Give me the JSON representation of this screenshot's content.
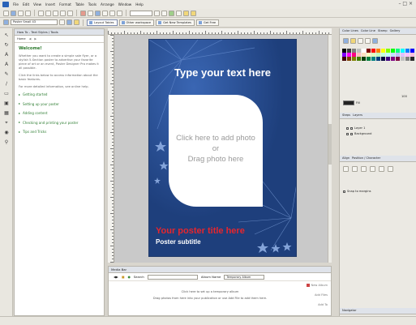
{
  "menu": {
    "items": [
      "File",
      "Edit",
      "View",
      "Insert",
      "Format",
      "Table",
      "Tools",
      "Arrange",
      "Window",
      "Help"
    ]
  },
  "toolbar2": {
    "style_combo": "Poster Small 43",
    "tabs": [
      "Layout Tables",
      "Other workspace",
      "Get New Templates",
      "Get Free"
    ]
  },
  "left_panel": {
    "title": "How To - Text Styles / Tools",
    "tab_home": "Home",
    "heading": "Welcome!",
    "intro": "Whether you want to create a simple sale flyer, or a stylish 5-Section poster to advertise your favorite piece of art or an event, Poster Designer Pro makes it all possible.",
    "guide": "Click the links below to access information about the basic features.",
    "more": "For more detailed information, see online help.",
    "links": [
      "Getting started",
      "Setting up your poster",
      "Adding content",
      "Checking and printing your poster",
      "Tips and Tricks"
    ]
  },
  "poster": {
    "title": "Type your text here",
    "photo_line1": "Click here to add photo",
    "photo_line2": "or",
    "photo_line3": "Drag photo here",
    "red_title": "Your poster title here",
    "subtitle": "Poster subtitle"
  },
  "bottom_panel": {
    "title": "Media Bar",
    "search_label": "Search",
    "album_label": "Album Name",
    "album_value": "Temporary Album",
    "msg1": "Click here to set up a temporary album",
    "msg2": "Drag photos from here into your publication or use Add File to add them here.",
    "btn_new_album": "New Album",
    "btn_add_files": "Add Files",
    "btn_add_to": "Add To"
  },
  "right_panel": {
    "color_tabs": [
      "Color Lines",
      "Color Line",
      "Stamp",
      "Gallery"
    ],
    "layers_tabs": [
      "Steps",
      "Layers"
    ],
    "layer_items": [
      "Layer 1",
      "Background"
    ],
    "align_tabs": [
      "Align",
      "Position / Character"
    ],
    "snap_label": "Snap to margins",
    "navigator": "Navigator",
    "zoom_label": "Fill",
    "percent_value": "100"
  },
  "colors": {
    "poster_bg": "#1e3f7c",
    "red_title": "#e6262d",
    "link_green": "#2e7d32",
    "heading_green": "#2c7a2c",
    "swatches": [
      "#000000",
      "#404040",
      "#7f7f7f",
      "#bfbfbf",
      "#ffffff",
      "#7f0000",
      "#ff0000",
      "#ff7f00",
      "#ffff00",
      "#7fff00",
      "#00ff00",
      "#00ff7f",
      "#00ffff",
      "#007fff",
      "#0000ff",
      "#7f00ff",
      "#ff00ff",
      "#ff007f",
      "#ffbfbf",
      "#ffdfbf",
      "#ffffbf",
      "#dfffbf",
      "#bfffbf",
      "#bfffdf",
      "#bfffff",
      "#bfdfff",
      "#bfbfff",
      "#dfbfff",
      "#ffbfff",
      "#ffbfdf",
      "#3f0000",
      "#7f3f00",
      "#7f7f00",
      "#3f7f00",
      "#003f00",
      "#007f3f",
      "#007f7f",
      "#003f7f",
      "#00003f",
      "#3f007f",
      "#7f007f",
      "#7f003f",
      "#c0c0c0",
      "#808080",
      "#2a2a2a"
    ]
  }
}
